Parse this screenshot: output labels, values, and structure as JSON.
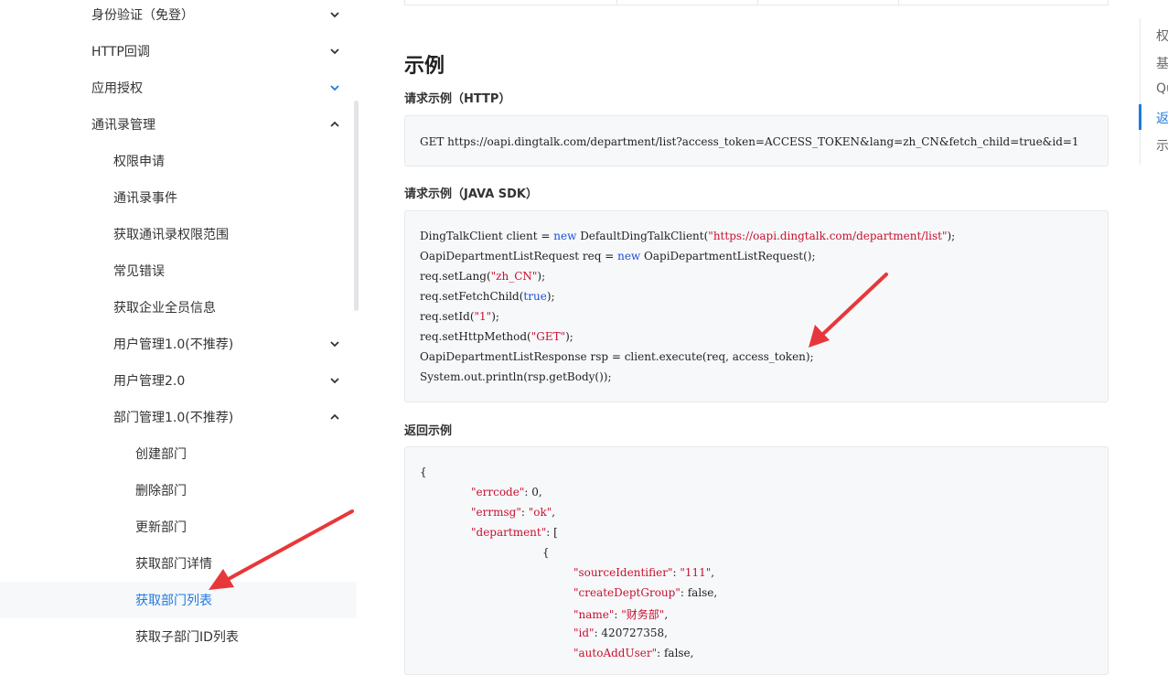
{
  "sidebar": {
    "items": [
      {
        "label": "身份验证（免登）",
        "chevron": "down"
      },
      {
        "label": "HTTP回调",
        "chevron": "down"
      },
      {
        "label": "应用授权",
        "chevron": "down-blue"
      },
      {
        "label": "通讯录管理",
        "chevron": "up"
      },
      {
        "label": "权限申请"
      },
      {
        "label": "通讯录事件"
      },
      {
        "label": "获取通讯录权限范围"
      },
      {
        "label": "常见错误"
      },
      {
        "label": "获取企业全员信息"
      },
      {
        "label": "用户管理1.0(不推荐)",
        "chevron": "down"
      },
      {
        "label": "用户管理2.0",
        "chevron": "down"
      },
      {
        "label": "部门管理1.0(不推荐)",
        "chevron": "up"
      },
      {
        "label": "创建部门"
      },
      {
        "label": "删除部门"
      },
      {
        "label": "更新部门"
      },
      {
        "label": "获取部门详情"
      },
      {
        "label": "获取部门列表",
        "active": true
      },
      {
        "label": "获取子部门ID列表"
      }
    ]
  },
  "content": {
    "section_title": "示例",
    "http_example_title": "请求示例（HTTP）",
    "http_example_code": "GET https://oapi.dingtalk.com/department/list?access_token=ACCESS_TOKEN&lang=zh_CN&fetch_child=true&id=1",
    "java_example_title": "请求示例（JAVA SDK）",
    "java_example_lines": [
      "DingTalkClient client = new DefaultDingTalkClient(\"https://oapi.dingtalk.com/department/list\");",
      "OapiDepartmentListRequest req = new OapiDepartmentListRequest();",
      "req.setLang(\"zh_CN\");",
      "req.setFetchChild(true);",
      "req.setId(\"1\");",
      "req.setHttpMethod(\"GET\");",
      "OapiDepartmentListResponse rsp = client.execute(req, access_token);",
      "System.out.println(rsp.getBody());"
    ],
    "java_tokens": {
      "l0_a": "DingTalkClient client = ",
      "l0_kw": "new",
      "l0_b": " DefaultDingTalkClient(",
      "l0_str": "\"https://oapi.dingtalk.com/department/list\"",
      "l0_c": ");",
      "l1_a": "OapiDepartmentListRequest req = ",
      "l1_kw": "new",
      "l1_b": " OapiDepartmentListRequest();",
      "l2_a": "req.setLang(",
      "l2_str": "\"zh_CN\"",
      "l2_b": ");",
      "l3_a": "req.setFetchChild(",
      "l3_kw": "true",
      "l3_b": ");",
      "l4_a": "req.setId(",
      "l4_str": "\"1\"",
      "l4_b": ");",
      "l5_a": "req.setHttpMethod(",
      "l5_str": "\"GET\"",
      "l5_b": ");",
      "l6": "OapiDepartmentListResponse rsp = client.execute(req, access_token);",
      "l7": "System.out.println(rsp.getBody());"
    },
    "return_example_title": "返回示例",
    "return_tokens": {
      "r0": "{",
      "r1_key": "\"errcode\"",
      "r1_val": ": 0,",
      "r2_key": "\"errmsg\"",
      "r2_sep": ": ",
      "r2_str": "\"ok\"",
      "r2_end": ",",
      "r3_key": "\"department\"",
      "r3_val": ": [",
      "r4": "{",
      "r5_key": "\"sourceIdentifier\"",
      "r5_sep": ": ",
      "r5_str": "\"111\"",
      "r5_end": ",",
      "r6_key": "\"createDeptGroup\"",
      "r6_val": ": false,",
      "r7_key": "\"name\"",
      "r7_sep": ": ",
      "r7_str": "\"财务部\"",
      "r7_end": ",",
      "r8_key": "\"id\"",
      "r8_val": ": 420727358,",
      "r9_key": "\"autoAddUser\"",
      "r9_val": ": false,"
    }
  },
  "toc": {
    "items": [
      {
        "label": "权"
      },
      {
        "label": "基"
      },
      {
        "label": "Qu"
      },
      {
        "label": "返",
        "active": true
      },
      {
        "label": "示"
      }
    ]
  },
  "colors": {
    "accent": "#1f7ae0",
    "string": "#c8102e",
    "keyword": "#1c4fd6",
    "annotation_arrow": "#e8373a"
  }
}
